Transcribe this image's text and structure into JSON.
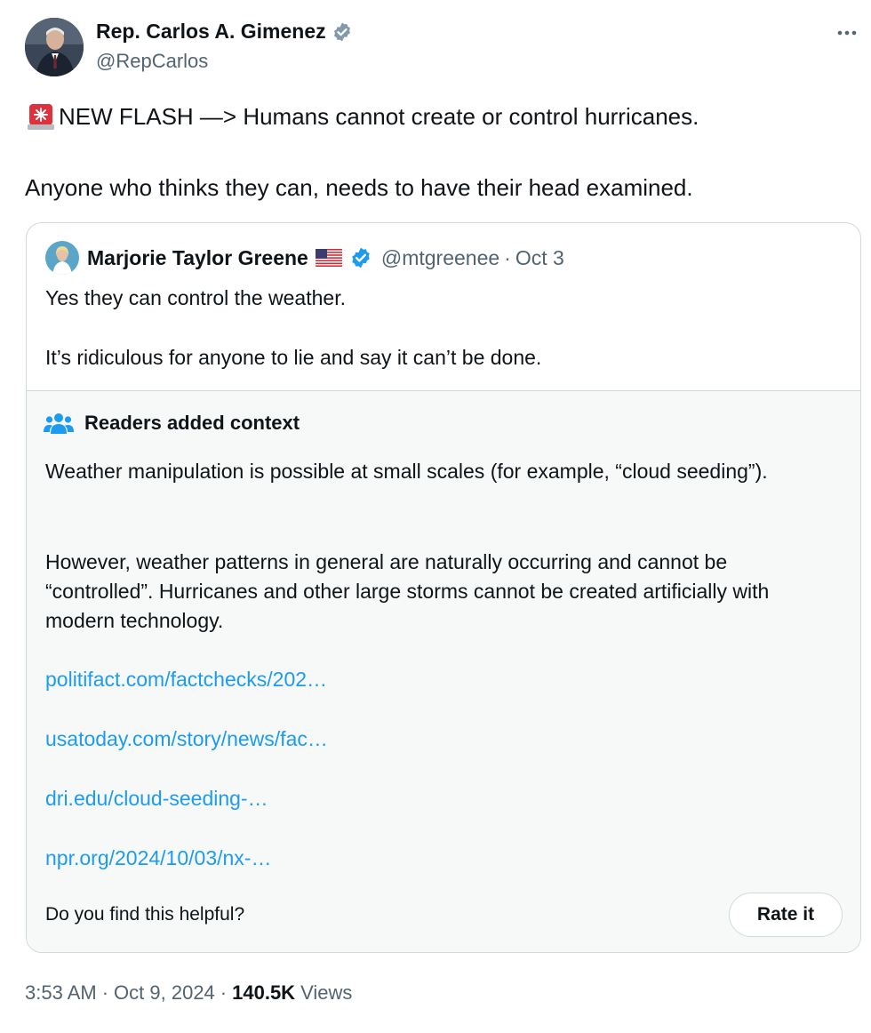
{
  "author": {
    "name": "Rep. Carlos A. Gimenez",
    "handle": "@RepCarlos",
    "verified_color": "#829aab"
  },
  "tweet": {
    "line1": "NEW FLASH —> Humans cannot create or control hurricanes.",
    "line2": "Anyone who thinks they can, needs to have their head examined.",
    "siren_icon": "siren-icon"
  },
  "quoted": {
    "name": "Marjorie Taylor Greene",
    "flag": "us-flag-icon",
    "handle": "@mtgreenee",
    "separator": "·",
    "date": "Oct 3",
    "verified_color": "#1d9bf0",
    "text1": "Yes they can control the weather.",
    "text2": "It’s ridiculous for anyone to lie and say it can’t be done."
  },
  "notes": {
    "title": "Readers added context",
    "para1": "Weather manipulation is possible at small scales (for example, “cloud seeding”).",
    "para2": "However, weather patterns in general are naturally occurring and cannot be “controlled”. Hurricanes and other large storms cannot be created artificially with modern technology.",
    "links": [
      "politifact.com/factchecks/202…",
      "usatoday.com/story/news/fac…",
      "dri.edu/cloud-seeding-…",
      "npr.org/2024/10/03/nx-…"
    ],
    "helpful_question": "Do you find this helpful?",
    "rate_label": "Rate it",
    "link_color": "#1d9bf0"
  },
  "footer": {
    "time": "3:53 AM",
    "dot": "·",
    "date": "Oct 9, 2024",
    "views_count": "140.5K",
    "views_label": "Views"
  }
}
